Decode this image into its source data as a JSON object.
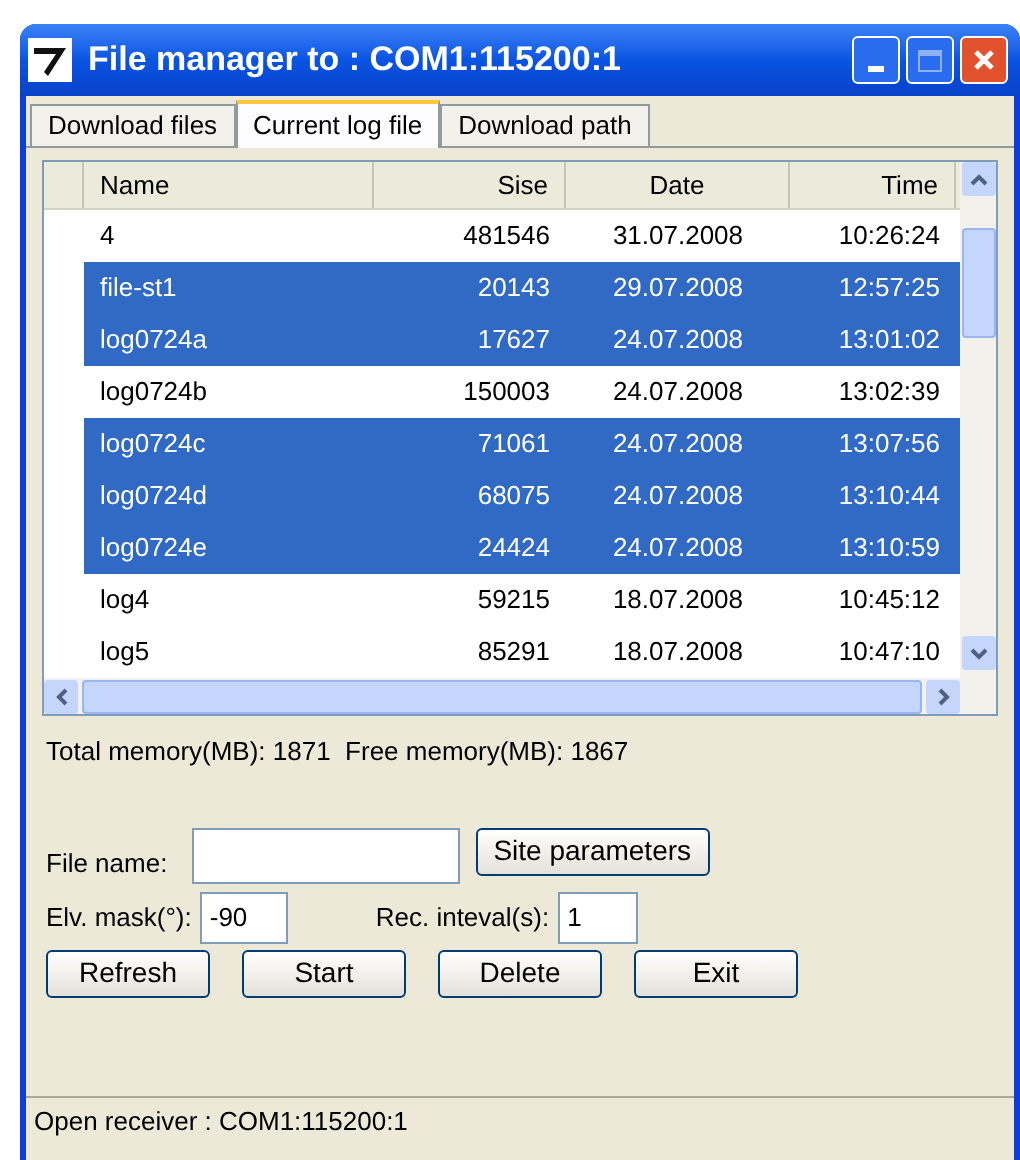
{
  "window": {
    "title": "File manager to : COM1:115200:1"
  },
  "tabs": [
    {
      "label": "Download files",
      "selected": false
    },
    {
      "label": "Current log file",
      "selected": true
    },
    {
      "label": "Download path",
      "selected": false
    }
  ],
  "table": {
    "columns": [
      "Name",
      "Sise",
      "Date",
      "Time"
    ],
    "rows": [
      {
        "cells": [
          "4",
          "481546",
          "31.07.2008",
          "10:26:24"
        ],
        "selected": false
      },
      {
        "cells": [
          "file-st1",
          "20143",
          "29.07.2008",
          "12:57:25"
        ],
        "selected": true
      },
      {
        "cells": [
          "log0724a",
          "17627",
          "24.07.2008",
          "13:01:02"
        ],
        "selected": true
      },
      {
        "cells": [
          "log0724b",
          "150003",
          "24.07.2008",
          "13:02:39"
        ],
        "selected": false
      },
      {
        "cells": [
          "log0724c",
          "71061",
          "24.07.2008",
          "13:07:56"
        ],
        "selected": true
      },
      {
        "cells": [
          "log0724d",
          "68075",
          "24.07.2008",
          "13:10:44"
        ],
        "selected": true
      },
      {
        "cells": [
          "log0724e",
          "24424",
          "24.07.2008",
          "13:10:59"
        ],
        "selected": true
      },
      {
        "cells": [
          "log4",
          "59215",
          "18.07.2008",
          "10:45:12"
        ],
        "selected": false
      },
      {
        "cells": [
          "log5",
          "85291",
          "18.07.2008",
          "10:47:10"
        ],
        "selected": false
      }
    ]
  },
  "memory_info": "Total memory(MB): 1871  Free memory(MB): 1867",
  "file_name": {
    "label": "File name:"
  },
  "site_parameters_button": "Site parameters",
  "elevation_mask": {
    "label": "Elv. mask(°):",
    "value": "-90"
  },
  "record_interval": {
    "label": "Rec. inteval(s):",
    "value": "1"
  },
  "buttons": [
    "Refresh",
    "Start",
    "Delete",
    "Exit"
  ],
  "status_bar": "Open receiver : COM1:115200:1"
}
